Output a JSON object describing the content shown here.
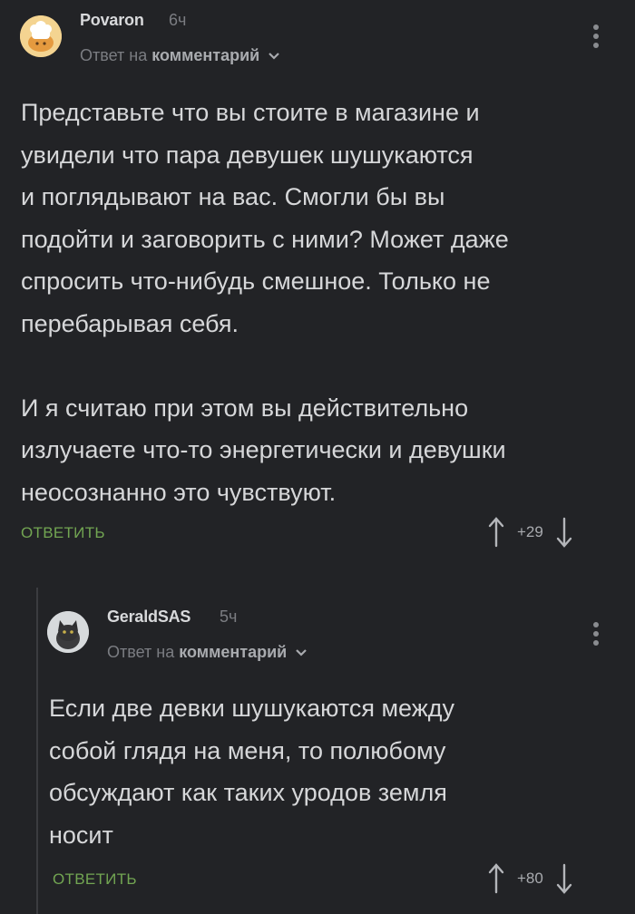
{
  "comments": [
    {
      "username": "Povaron",
      "time": "6ч",
      "reply_prefix": "Ответ на",
      "reply_target": "комментарий",
      "avatar_icon": "chef-hat-avatar",
      "body": "Представьте что вы стоите в магазине и\nувидели что пара девушек шушукаются\nи поглядывают на вас. Смогли бы вы\nподойти и заговорить с ними? Может даже\nспросить что-нибудь смешное. Только не\nперебарывая себя.\n\nИ я считаю при этом вы действительно\nизлучаете что-то энергетически и девушки\nнеосознанно это чувствуют.",
      "reply_label": "ОТВЕТИТЬ",
      "rating": "+29"
    },
    {
      "username": "GeraldSAS",
      "time": "5ч",
      "reply_prefix": "Ответ на",
      "reply_target": "комментарий",
      "avatar_icon": "cat-avatar",
      "body": "Если две девки шушукаются между\nсобой глядя на меня, то полюбому\nобсуждают как таких уродов земля\nносит",
      "reply_label": "ОТВЕТИТЬ",
      "rating": "+80"
    }
  ],
  "colors": {
    "background": "#222326",
    "reply_accent": "#72a552",
    "muted": "#7b7d82"
  }
}
